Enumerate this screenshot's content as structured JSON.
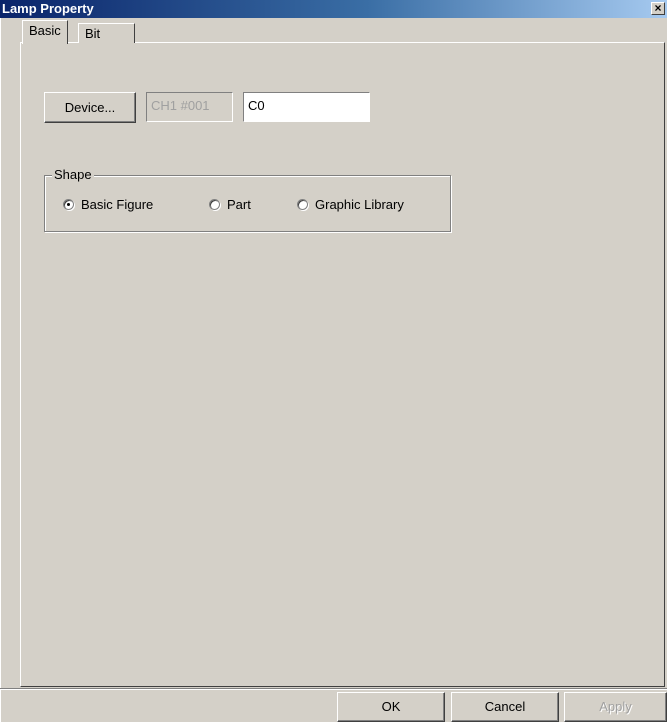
{
  "window": {
    "title": "Lamp Property",
    "close_glyph": "×"
  },
  "tabs": [
    {
      "label": "Basic"
    },
    {
      "label": "Bit"
    }
  ],
  "device": {
    "button_label": "Device...",
    "channel_value": "CH1 #001",
    "address_value": "C0"
  },
  "shape": {
    "group_label": "Shape",
    "options": [
      {
        "label": "Basic Figure",
        "selected": true
      },
      {
        "label": "Part",
        "selected": false
      },
      {
        "label": "Graphic Library",
        "selected": false
      }
    ]
  },
  "footer": {
    "ok_label": "OK",
    "cancel_label": "Cancel",
    "apply_label": "Apply"
  },
  "colors": {
    "titlebar_start": "#0a246a",
    "titlebar_end": "#a6caf0",
    "face": "#d4d0c8",
    "disabled_text": "#a0a0a0"
  }
}
